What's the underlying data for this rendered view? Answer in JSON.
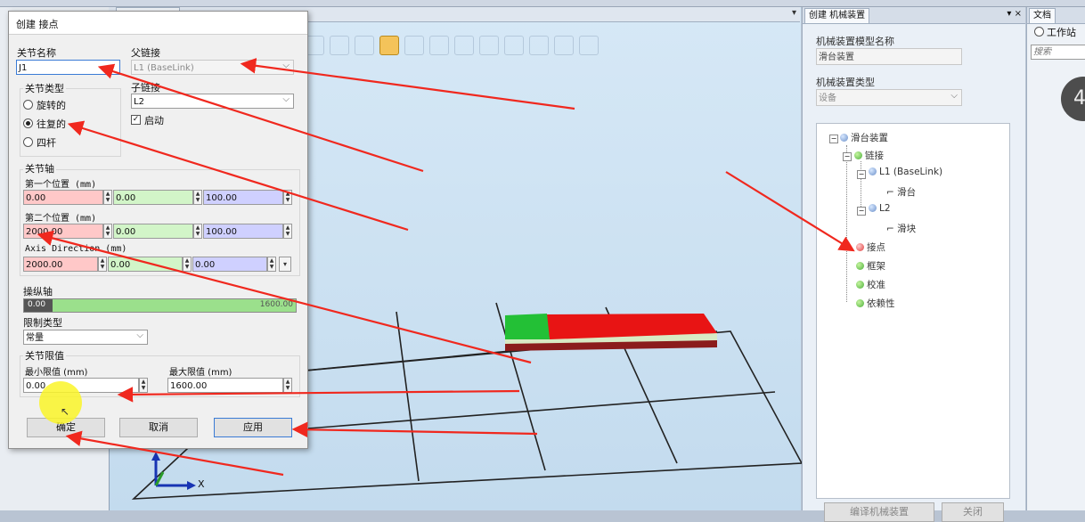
{
  "viewport_tab": "",
  "viewport_menu": "▾",
  "dialog": {
    "title": "创建 接点",
    "joint_name_label": "关节名称",
    "joint_name_value": "J1",
    "parent_link_label": "父链接",
    "parent_link_value": "L1 (BaseLink)",
    "child_link_label": "子链接",
    "child_link_value": "L2",
    "enable_label": "启动",
    "joint_type_label": "关节类型",
    "radio_rotary": "旋转的",
    "radio_prismatic": "往复的",
    "radio_fourbar": "四杆",
    "joint_axis_label": "关节轴",
    "first_pos_label": "第一个位置 (mm)",
    "first_pos": [
      "0.00",
      "0.00",
      "100.00"
    ],
    "second_pos_label": "第二个位置 (mm)",
    "second_pos": [
      "2000.00",
      "0.00",
      "100.00"
    ],
    "axis_dir_label": "Axis Direction (mm)",
    "axis_dir": [
      "2000.00",
      "0.00",
      "0.00"
    ],
    "jog_axis_label": "操纵轴",
    "jog_min": "0.00",
    "jog_max": "1600.00",
    "limit_type_label": "限制类型",
    "limit_type_value": "常量",
    "joint_limits_label": "关节限值",
    "min_limit_label": "最小限值 (mm)",
    "min_limit_value": "0.00",
    "max_limit_label": "最大限值 (mm)",
    "max_limit_value": "1600.00",
    "ok_button": "确定",
    "cancel_button": "取消",
    "apply_button": "应用"
  },
  "mech_panel": {
    "tab_label": "创建 机械装置",
    "controls": "▾ ×",
    "model_name_label": "机械装置模型名称",
    "model_name_value": "滑台装置",
    "type_label": "机械装置类型",
    "type_value": "设备",
    "tree": {
      "root": "滑台装置",
      "links": "链接",
      "l1": "L1 (BaseLink)",
      "l1_part": "滑台",
      "l2": "L2",
      "l2_part": "滑块",
      "joints": "接点",
      "frames": "框架",
      "calibration": "校准",
      "dependency": "依赖性"
    },
    "compile_button": "编译机械装置",
    "close_button": "关闭"
  },
  "doc_panel": {
    "tab_label": "文档",
    "radio_workstation": "工作站",
    "search_placeholder": "搜索",
    "badge": "4"
  },
  "axis_x_label": "X",
  "colors": {
    "annotation_arrow": "#f0281e",
    "prismatic_base": "#e81414",
    "slider_block": "#23c036"
  }
}
